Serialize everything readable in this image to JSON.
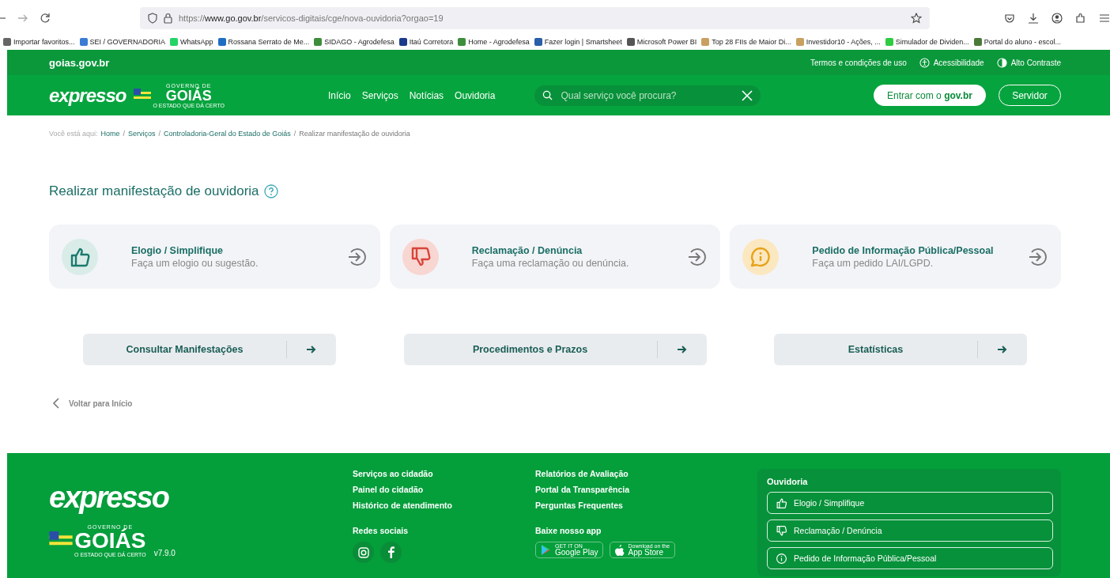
{
  "browser": {
    "url_scheme": "https://",
    "url_domain": "www.go.gov.br",
    "url_path": "/servicos-digitais/cge/nova-ouvidoria?orgao=19",
    "bookmarks": [
      {
        "label": "Importar favoritos...",
        "color": "#666666"
      },
      {
        "label": "SEI / GOVERNADORIA",
        "color": "#3a7bd5"
      },
      {
        "label": "WhatsApp",
        "color": "#25d366"
      },
      {
        "label": "Rossana Serrato de Me...",
        "color": "#1e6fc4"
      },
      {
        "label": "SIDAGO - Agrodefesa",
        "color": "#3c8d3c"
      },
      {
        "label": "Itaú Corretora",
        "color": "#1a3a8a"
      },
      {
        "label": "Home - Agrodefesa",
        "color": "#3c8d3c"
      },
      {
        "label": "Fazer login | Smartsheet",
        "color": "#2a5ea8"
      },
      {
        "label": "Microsoft Power BI",
        "color": "#555555"
      },
      {
        "label": "Top 28 FIIs de Maior Di...",
        "color": "#c8a060"
      },
      {
        "label": "Investidor10 - Ações, ...",
        "color": "#c8a060"
      },
      {
        "label": "Simulador de Dividen...",
        "color": "#2ecc40"
      },
      {
        "label": "Portal do aluno - escol...",
        "color": "#4a7a3a"
      }
    ]
  },
  "topbar": {
    "site": "goias.gov.br",
    "links": [
      {
        "label": "Termos e condições de uso",
        "kind": "plain"
      },
      {
        "label": "Acessibilidade",
        "kind": "accessibility"
      },
      {
        "label": "Alto Contraste",
        "kind": "contrast"
      }
    ]
  },
  "header": {
    "logo": "expresso",
    "state_logo": "GOIÁS",
    "state_tagline": "O ESTADO QUE DÁ CERTO",
    "state_top": "GOVERNO DE",
    "nav": [
      "Início",
      "Serviços",
      "Notícias",
      "Ouvidoria"
    ],
    "search": {
      "placeholder": "Qual serviço você procura?"
    },
    "login_prefix": "Entrar com o",
    "login_brand": "gov.br",
    "servidor": "Servidor"
  },
  "breadcrumb": {
    "prefix": "Você está aqui:",
    "links": [
      {
        "label": "Home",
        "sep": "/"
      },
      {
        "label": "Serviços",
        "sep": "/"
      },
      {
        "label": "Controladoria-Geral do Estado de Goiás",
        "sep": "/"
      }
    ],
    "current": "Realizar manifestação de ouvidoria"
  },
  "title": "Realizar manifestação de ouvidoria",
  "cards": [
    {
      "kind": "praise",
      "title": "Elogio / Simplifique",
      "text": "Faça um elogio ou sugestão."
    },
    {
      "kind": "complaint",
      "title": "Reclamação / Denúncia",
      "text": "Faça uma reclamação ou denúncia."
    },
    {
      "kind": "info",
      "title": "Pedido de Informação Pública/Pessoal",
      "text": "Faça um pedido LAI/LGPD."
    }
  ],
  "actions": [
    "Consultar Manifestações",
    "Procedimentos e Prazos",
    "Estatísticas"
  ],
  "back": "Voltar para Início",
  "footer": {
    "logo": "expresso",
    "state_logo": "GOIÁS",
    "state_tagline": "O ESTADO QUE DÁ CERTO",
    "state_top": "GOVERNO DE",
    "version": "v7.9.0",
    "col1": [
      "Serviços ao cidadão",
      "Painel do cidadão",
      "Histórico de atendimento"
    ],
    "social_title": "Redes sociais",
    "col2": [
      "Relatórios de Avaliação",
      "Portal da Transparência",
      "Perguntas Frequentes"
    ],
    "app_title": "Baixe nosso app",
    "stores": [
      {
        "kind": "google",
        "small": "GET IT ON",
        "big": "Google Play"
      },
      {
        "kind": "apple",
        "small": "Download on the",
        "big": "App Store"
      }
    ],
    "ouvidoria_title": "Ouvidoria",
    "ouvidoria": [
      {
        "kind": "praise",
        "label": "Elogio / Simplifique"
      },
      {
        "kind": "complaint",
        "label": "Reclamação / Denúncia"
      },
      {
        "kind": "info",
        "label": "Pedido de Informação Pública/Pessoal"
      }
    ]
  }
}
